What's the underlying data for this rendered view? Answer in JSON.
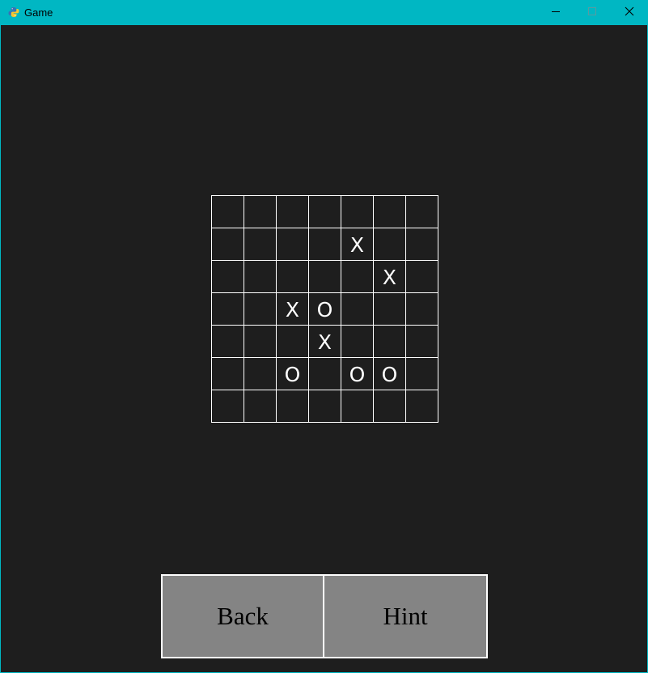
{
  "window": {
    "title": "Game",
    "accent_color": "#00b7c3",
    "controls": {
      "minimize_icon": "minimize-icon",
      "maximize_icon": "maximize-icon",
      "close_icon": "close-icon"
    }
  },
  "board": {
    "rows": 7,
    "cols": 7,
    "cells": [
      [
        "",
        "",
        "",
        "",
        "",
        "",
        ""
      ],
      [
        "",
        "",
        "",
        "",
        "X",
        "",
        ""
      ],
      [
        "",
        "",
        "",
        "",
        "",
        "X",
        ""
      ],
      [
        "",
        "",
        "X",
        "O",
        "",
        "",
        ""
      ],
      [
        "",
        "",
        "",
        "X",
        "",
        "",
        ""
      ],
      [
        "",
        "",
        "O",
        "",
        "O",
        "O",
        ""
      ],
      [
        "",
        "",
        "",
        "",
        "",
        "",
        ""
      ]
    ]
  },
  "buttons": {
    "back_label": "Back",
    "hint_label": "Hint"
  },
  "colors": {
    "background": "#1e1e1e",
    "grid_line": "#ffffff",
    "button_fill": "#848484"
  }
}
